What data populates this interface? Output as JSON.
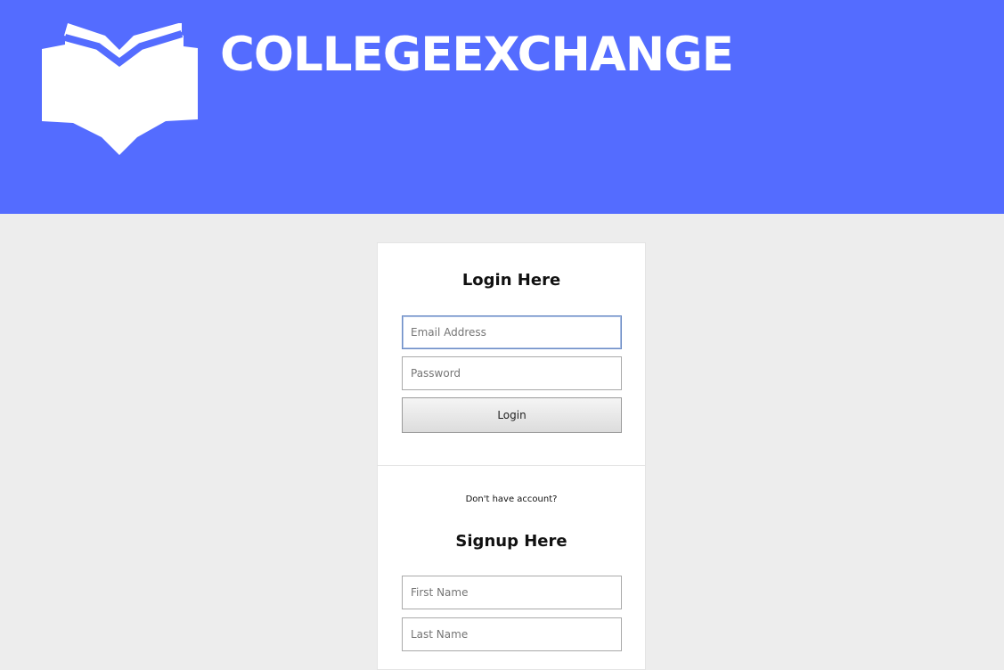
{
  "header": {
    "brand": "COLLEGEEXCHANGE",
    "logo_icon": "open-book-icon",
    "background_color": "#546cff"
  },
  "login": {
    "title": "Login Here",
    "email_placeholder": "Email Address",
    "password_placeholder": "Password",
    "button_label": "Login"
  },
  "signup": {
    "prompt": "Don't have account?",
    "title": "Signup Here",
    "first_name_placeholder": "First Name",
    "last_name_placeholder": "Last Name"
  }
}
